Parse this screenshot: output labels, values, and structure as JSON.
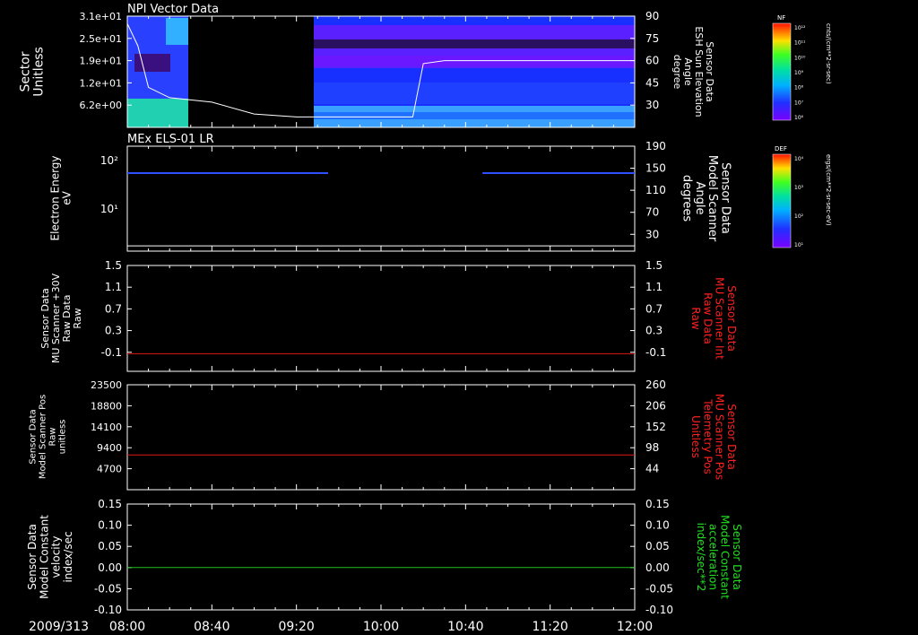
{
  "date_label": "2009/313",
  "time_ticks": [
    "08:00",
    "08:40",
    "09:20",
    "10:00",
    "10:40",
    "11:20",
    "12:00"
  ],
  "colors": {
    "background": "#000000",
    "axis": "#ffffff",
    "red_label": "#ff2020",
    "red_line": "#e01818",
    "green_label": "#20e020",
    "green_line": "#20c020"
  },
  "chart_data": [
    {
      "type": "heatmap",
      "title": "NPI Vector Data",
      "ylabel": [
        "Sector",
        "Unitless"
      ],
      "yticks": [
        "3.1e+01",
        "2.5e+01",
        "1.9e+01",
        "1.2e+01",
        "6.2e+00"
      ],
      "y2label": [
        "Sensor Data",
        "ESH Sun Elevation",
        "Angle",
        "degree"
      ],
      "y2ticks": [
        "90",
        "75",
        "60",
        "45",
        "30"
      ],
      "y2lim": [
        15,
        90
      ],
      "colorbar": {
        "label": "NF",
        "unit": "cnts/(cm**2-sr-sec)",
        "ticks": [
          "10¹²",
          "10¹¹",
          "10¹⁰",
          "10⁹",
          "10⁸",
          "10⁷",
          "10⁶"
        ]
      },
      "x": [
        "08:00",
        "08:10",
        "08:20",
        "08:30",
        "08:40",
        "08:50",
        "09:00",
        "09:10",
        "09:20",
        "09:30",
        "09:40",
        "10:00",
        "10:40",
        "11:20",
        "12:00"
      ],
      "sun_elevation_deg": [
        85,
        70,
        42,
        35,
        32,
        24,
        22,
        22,
        22,
        22,
        22,
        58,
        60,
        60,
        60,
        60
      ],
      "data_gap": [
        "08:13",
        "09:38"
      ]
    },
    {
      "type": "heatmap",
      "title": "MEx ELS-01 LR",
      "ylabel": [
        "Electron Energy",
        "eV"
      ],
      "yscale": "log",
      "yticks": [
        "10²",
        "10¹"
      ],
      "y2label": [
        "Sensor Data",
        "Model Scanner",
        "Angle",
        "degrees"
      ],
      "y2ticks": [
        "190",
        "150",
        "110",
        "70",
        "30"
      ],
      "y2lim": [
        0,
        190
      ],
      "colorbar": {
        "label": "DEF",
        "unit": "ergs/(cm**2-sr-sec-eV)",
        "ticks": [
          "10⁴",
          "10³",
          "10²",
          "10¹"
        ]
      },
      "energy_band_eV": 50,
      "band_intervals": [
        [
          "08:00",
          "09:35"
        ],
        [
          "10:48",
          "12:00"
        ]
      ],
      "scanner_angle_deg": 3
    },
    {
      "type": "line",
      "ylabel": [
        "Sensor Data",
        "MU Scanner +30V",
        "Raw Data",
        "Raw"
      ],
      "yticks": [
        "1.5",
        "1.1",
        "0.7",
        "0.3",
        "-0.1"
      ],
      "ylim": [
        -0.3,
        1.5
      ],
      "y2ticks": [
        "1.5",
        "1.1",
        "0.7",
        "0.3",
        "-0.1"
      ],
      "y2label": [
        "Sensor Data",
        "MU Scanner Int",
        "Raw Data",
        "Raw"
      ],
      "series": [
        {
          "name": "MU Scanner Int Raw Data",
          "value": 0.0
        }
      ]
    },
    {
      "type": "line",
      "ylabel": [
        "Sensor Data",
        "Model Scanner Pos",
        "Raw",
        "unitless"
      ],
      "yticks": [
        "23500",
        "18800",
        "14100",
        "9400",
        "4700"
      ],
      "ylim": [
        0,
        23500
      ],
      "y2ticks": [
        "260",
        "206",
        "152",
        "98",
        "44"
      ],
      "y2lim": [
        0,
        260
      ],
      "y2label": [
        "Sensor Data",
        "MU Scanner Pos",
        "Telemetry Pos",
        "Unitless"
      ],
      "series": [
        {
          "name": "MU Scanner Pos Telemetry Pos",
          "value": 86
        }
      ]
    },
    {
      "type": "line",
      "ylabel": [
        "Sensor Data",
        "Model Constant",
        "velocity",
        "index/sec"
      ],
      "yticks": [
        "0.15",
        "0.10",
        "0.05",
        "0.00",
        "-0.05",
        "-0.10"
      ],
      "ylim": [
        -0.1,
        0.15
      ],
      "y2ticks": [
        "0.15",
        "0.10",
        "0.05",
        "0.00",
        "-0.05",
        "-0.10"
      ],
      "y2label": [
        "Sensor Data",
        "Model Constant",
        "acceleration",
        "index/sec**2"
      ],
      "series": [
        {
          "name": "Model Constant acceleration",
          "value": 0.0
        }
      ]
    }
  ]
}
